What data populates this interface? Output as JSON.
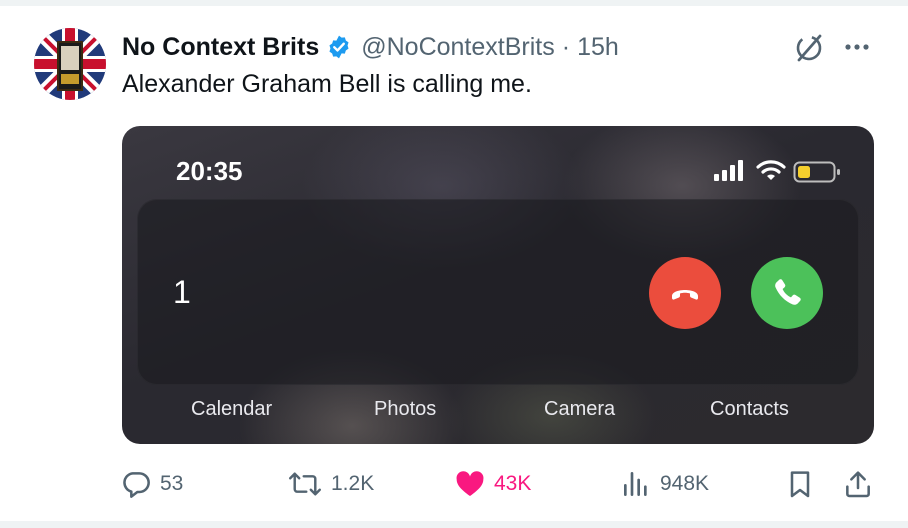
{
  "tweet": {
    "author": {
      "display_name": "No Context Brits",
      "handle": "@NoContextBrits",
      "separator": "·",
      "time": "15h",
      "verified": true,
      "avatar": "union-jack-phone-box-avatar"
    },
    "text": "Alexander Graham Bell is calling me.",
    "header_icons": [
      "grok-icon",
      "more-icon"
    ],
    "media": {
      "status_bar": {
        "time": "20:35",
        "icons": [
          "signal-icon",
          "wifi-icon",
          "battery-icon"
        ]
      },
      "incoming_call": {
        "caller": "1",
        "decline_icon": "phone-hangup-icon",
        "accept_icon": "phone-icon",
        "decline_color": "#eb4d3d",
        "accept_color": "#4cc15a"
      },
      "dock_labels": [
        "Calendar",
        "Photos",
        "Camera",
        "Contacts"
      ]
    },
    "actions": {
      "replies": "53",
      "reposts": "1.2K",
      "likes": "43K",
      "views": "948K",
      "like_color": "#f91880"
    }
  }
}
